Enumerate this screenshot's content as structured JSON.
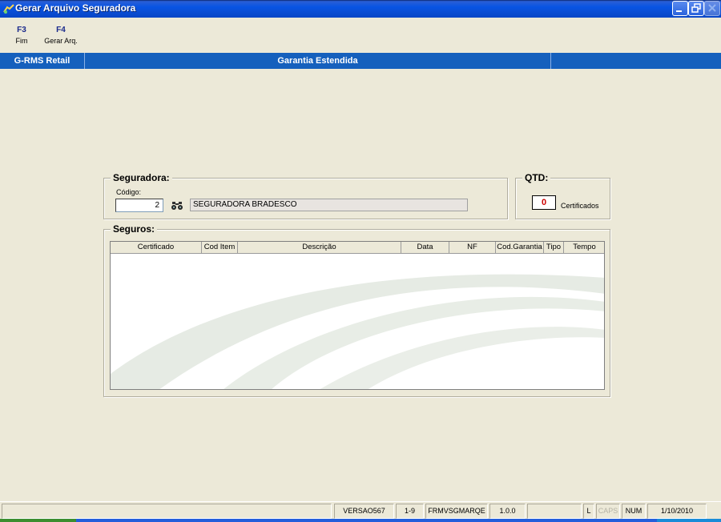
{
  "window": {
    "title": "Gerar Arquivo Seguradora"
  },
  "toolbar": {
    "items": [
      {
        "key": "F3",
        "label": "Fim"
      },
      {
        "key": "F4",
        "label": "Gerar Arq."
      }
    ]
  },
  "header": {
    "app_name": "G-RMS Retail",
    "screen_title": "Garantia Estendida"
  },
  "seguradora": {
    "title": "Seguradora:",
    "codigo_label": "Código:",
    "codigo_value": "2",
    "nome_value": "SEGURADORA BRADESCO"
  },
  "qtd": {
    "title": "QTD:",
    "value": "0",
    "label": "Certificados"
  },
  "seguros": {
    "title": "Seguros:",
    "columns": [
      "Certificado",
      "Cod Item",
      "Descrição",
      "Data",
      "NF",
      "Cod.Garantia",
      "Tipo",
      "Tempo"
    ],
    "rows": []
  },
  "statusbar": {
    "panels": [
      "",
      "VERSAO567",
      "1-9",
      "FRMVSGMARQE",
      "1.0.0",
      "",
      "L",
      "CAPS",
      "NUM",
      "1/10/2010"
    ]
  },
  "colors": {
    "header_bar": "#1560bd",
    "qtd_value": "#cc0000",
    "toolbar_key": "#1a2a8c"
  }
}
